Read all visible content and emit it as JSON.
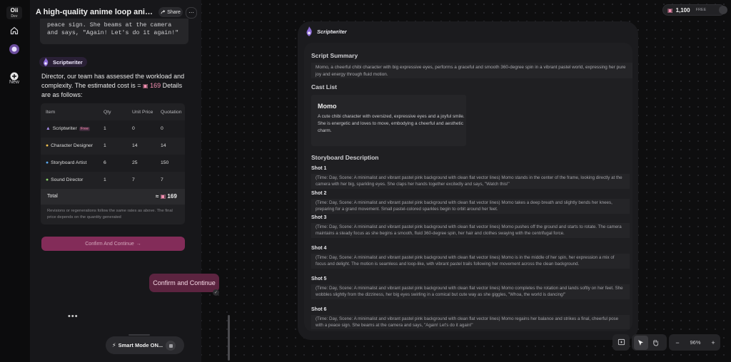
{
  "app": {
    "logo_text": "Oii",
    "logo_sub": "Dev",
    "rail": {
      "new_label": "New"
    }
  },
  "chat": {
    "title": "A high-quality anime loop animati...",
    "share_label": "Share",
    "more_label": "⋯",
    "previous_tail": "peace sign. She beams at the camera and says, \"Again! Let's do it again!\"",
    "agent_name": "Scriptwriter",
    "message_prefix": "Director, our team has assessed the workload and complexity. The estimated cost is = ",
    "message_cost": "169",
    "message_suffix": " Details are as follows:",
    "table": {
      "headers": [
        "Item",
        "Qty",
        "Unit Price",
        "Quotation"
      ],
      "rows": [
        {
          "item": "Scriptwriter",
          "badge": "Free",
          "qty": "1",
          "unit": "0",
          "quote": "0"
        },
        {
          "item": "Character Designer",
          "badge": "",
          "qty": "1",
          "unit": "14",
          "quote": "14"
        },
        {
          "item": "Storyboard Artist",
          "badge": "",
          "qty": "6",
          "unit": "25",
          "quote": "150"
        },
        {
          "item": "Sound Director",
          "badge": "",
          "qty": "1",
          "unit": "7",
          "quote": "7"
        }
      ],
      "total_label": "Total",
      "total_prefix": "≈",
      "total_value": "169",
      "note": "Revisions or regenerations follow the same rates as above. The final price depends on the quantity generated"
    },
    "confirm_bar_label": "Confirm And Continue",
    "user_message": "Confirm and Continue",
    "typing_indicator": "•••",
    "smart_mode_label": "Smart Mode ON..."
  },
  "script": {
    "agent_name": "Scriptwriter",
    "summary_title": "Script Summary",
    "summary_text": "Momo, a cheerful chibi character with big expressive eyes, performs a graceful and smooth 360-degree spin in a vibrant pastel world, expressing her pure joy and energy through fluid motion.",
    "cast_title": "Cast List",
    "cast": [
      {
        "name": "Momo",
        "description": "A cute chibi character with oversized, expressive eyes and a joyful smile. She is energetic and loves to move, embodying a cheerful and aesthetic charm."
      }
    ],
    "storyboard_title": "Storyboard Description",
    "shots": [
      {
        "title": "Shot 1",
        "text": "(Time: Day, Scene: A minimalist and vibrant pastel pink background with clean flat vector lines) Momo stands in the center of the frame, looking directly at the camera with her big, sparkling eyes. She claps her hands together excitedly and says, \"Watch this!\""
      },
      {
        "title": "Shot 2",
        "text": "(Time: Day, Scene: A minimalist and vibrant pastel pink background with clean flat vector lines) Momo takes a deep breath and slightly bends her knees, preparing for a grand movement. Small pastel-colored sparkles begin to orbit around her feet."
      },
      {
        "title": "Shot 3",
        "text": "(Time: Day, Scene: A minimalist and vibrant pastel pink background with clean flat vector lines) Momo pushes off the ground and starts to rotate. The camera maintains a steady focus as she begins a smooth, fluid 360-degree spin, her hair and clothes swaying with the centrifugal force."
      },
      {
        "title": "Shot 4",
        "text": "(Time: Day, Scene: A minimalist and vibrant pastel pink background with clean flat vector lines) Momo is in the middle of her spin, her expression a mix of focus and delight. The motion is seamless and loop-like, with vibrant pastel trails following her movement across the clean background."
      },
      {
        "title": "Shot 5",
        "text": "(Time: Day, Scene: A minimalist and vibrant pastel pink background with clean flat vector lines) Momo completes the rotation and lands softly on her feet. She wobbles slightly from the dizziness, her big eyes swirling in a comical but cute way as she giggles, \"Whoa, the world is dancing!\""
      },
      {
        "title": "Shot 6",
        "text": "(Time: Day, Scene: A minimalist and vibrant pastel pink background with clean flat vector lines) Momo regains her balance and strikes a final, cheerful pose with a peace sign. She beams at the camera and says, \"Again! Let's do it again!\""
      }
    ]
  },
  "topbar": {
    "credits": "1,100",
    "plan": "FREE"
  },
  "toolbar": {
    "zoom": "96%",
    "zoom_out": "−",
    "zoom_in": "+"
  },
  "colors": {
    "accent": "#8f2f60",
    "cost_pink": "#f48fb1",
    "panel": "#17171a"
  }
}
